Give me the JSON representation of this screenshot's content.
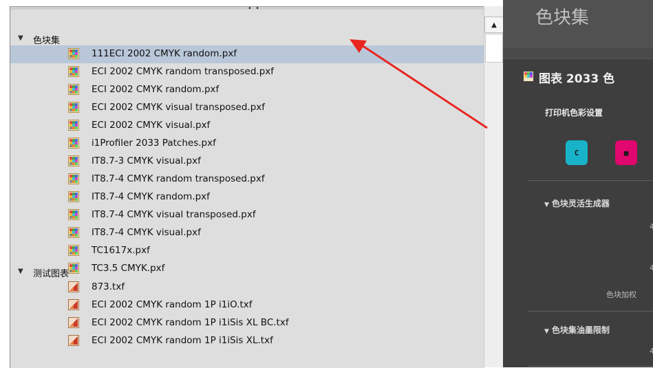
{
  "tree": {
    "drag_handle": "• •",
    "groups": [
      {
        "label": "色块集",
        "items": [
          "111ECI 2002 CMYK random.pxf",
          "ECI 2002 CMYK random transposed.pxf",
          "ECI 2002 CMYK random.pxf",
          "ECI 2002 CMYK visual transposed.pxf",
          "ECI 2002 CMYK visual.pxf",
          "i1Profiler 2033 Patches.pxf",
          "IT8.7-3 CMYK visual.pxf",
          "IT8.7-4 CMYK random transposed.pxf",
          "IT8.7-4 CMYK random.pxf",
          "IT8.7-4 CMYK visual transposed.pxf",
          "IT8.7-4 CMYK visual.pxf",
          "TC1617x.pxf",
          "TC3.5 CMYK.pxf"
        ]
      },
      {
        "label": "测试图表",
        "items": [
          "873.txf",
          "ECI 2002 CMYK random 1P i1iO.txf",
          "ECI 2002 CMYK random 1P i1iSis XL BC.txf",
          "ECI 2002 CMYK random 1P i1iSis XL.txf"
        ]
      }
    ],
    "expand_glyph": "▼",
    "selected_item": "111ECI 2002 CMYK random.pxf"
  },
  "scrollbar": {
    "up_glyph": "▲"
  },
  "right_panel": {
    "title": "色块集",
    "chart_label": "图表 2033 色",
    "printer_settings": "打印机色彩设置",
    "swatches": [
      {
        "label": "C",
        "color": "#18b3c8"
      },
      {
        "label": "■",
        "color": "#e0076e"
      }
    ],
    "section_generator": "色块灵活生成器",
    "generator_fragment_1": "4",
    "generator_fragment_2": "4",
    "patch_weight": "色块加权",
    "section_ink_limit": "色块集油墨限制",
    "ink_fragment": "4"
  },
  "colors": {
    "annotation_arrow": "#e8261f",
    "selection": "#b9c7d9",
    "panel_dark": "#3e3e3e"
  },
  "icons": {
    "pxf_file": "patch-set-file-icon",
    "txf_file": "test-chart-file-icon",
    "chart": "chart-icon"
  }
}
